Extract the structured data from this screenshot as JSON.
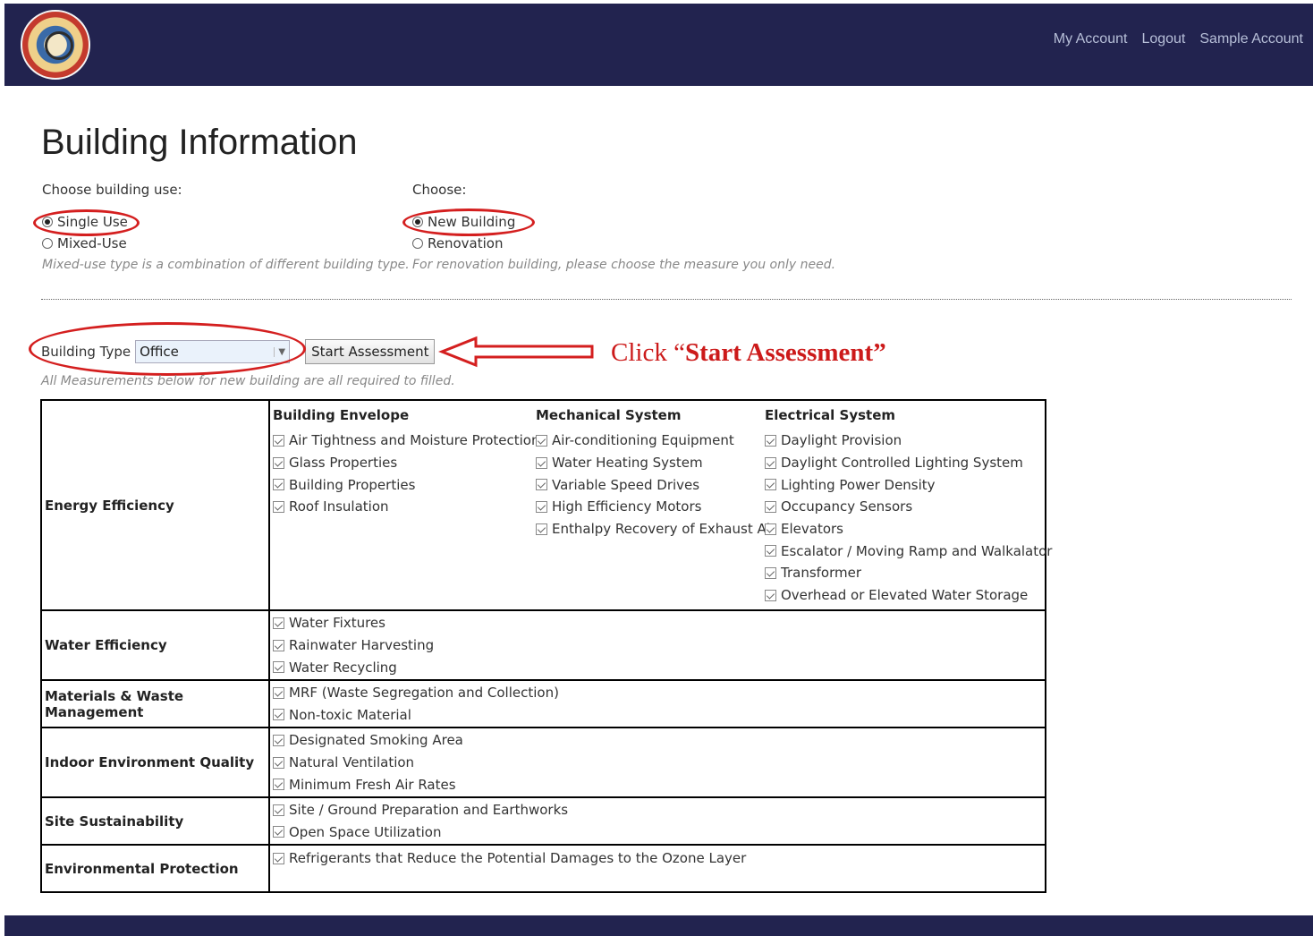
{
  "nav": {
    "links": [
      "My Account",
      "Logout",
      "Sample Account"
    ]
  },
  "page": {
    "title": "Building Information",
    "use_label": "Choose building use:",
    "use_options": [
      "Single Use",
      "Mixed-Use"
    ],
    "use_selected": "Single Use",
    "choose_label": "Choose:",
    "choose_options": [
      "New Building",
      "Renovation"
    ],
    "choose_selected": "New Building",
    "hint_mixed": "Mixed-use type is a combination of different building type.",
    "hint_renovation": "For renovation building, please choose the measure you only need.",
    "building_type_label": "Building Type",
    "building_type_value": "Office",
    "start_button": "Start Assessment",
    "callout_prefix": "Click “",
    "callout_bold": "Start Assessment”",
    "required_hint": "All Measurements below for new building are all required to filled."
  },
  "colors": {
    "navbar": "#22234f",
    "annotation_red": "#d41f1f"
  },
  "energy": {
    "category": "Energy Efficiency",
    "columns": [
      {
        "header": "Building Envelope",
        "items": [
          "Air Tightness and Moisture Protection",
          "Glass Properties",
          "Building Properties",
          "Roof Insulation"
        ]
      },
      {
        "header": "Mechanical System",
        "items": [
          "Air-conditioning Equipment",
          "Water Heating System",
          "Variable Speed Drives",
          "High Efficiency Motors",
          "Enthalpy Recovery of Exhaust Air"
        ]
      },
      {
        "header": "Electrical System",
        "items": [
          "Daylight Provision",
          "Daylight Controlled Lighting System",
          "Lighting Power Density",
          "Occupancy Sensors",
          "Elevators",
          "Escalator / Moving Ramp and Walkalator",
          "Transformer",
          "Overhead or Elevated Water Storage"
        ]
      }
    ]
  },
  "categories": [
    {
      "name": "Water Efficiency",
      "items": [
        "Water Fixtures",
        "Rainwater Harvesting",
        "Water Recycling"
      ]
    },
    {
      "name": "Materials & Waste Management",
      "items": [
        "MRF (Waste Segregation and Collection)",
        "Non-toxic Material"
      ]
    },
    {
      "name": "Indoor Environment Quality",
      "items": [
        "Designated Smoking Area",
        "Natural Ventilation",
        "Minimum Fresh Air Rates"
      ]
    },
    {
      "name": "Site Sustainability",
      "items": [
        "Site / Ground Preparation and Earthworks",
        "Open Space Utilization"
      ]
    },
    {
      "name": "Environmental Protection",
      "items": [
        "Refrigerants that Reduce the Potential Damages to the Ozone Layer"
      ]
    }
  ]
}
